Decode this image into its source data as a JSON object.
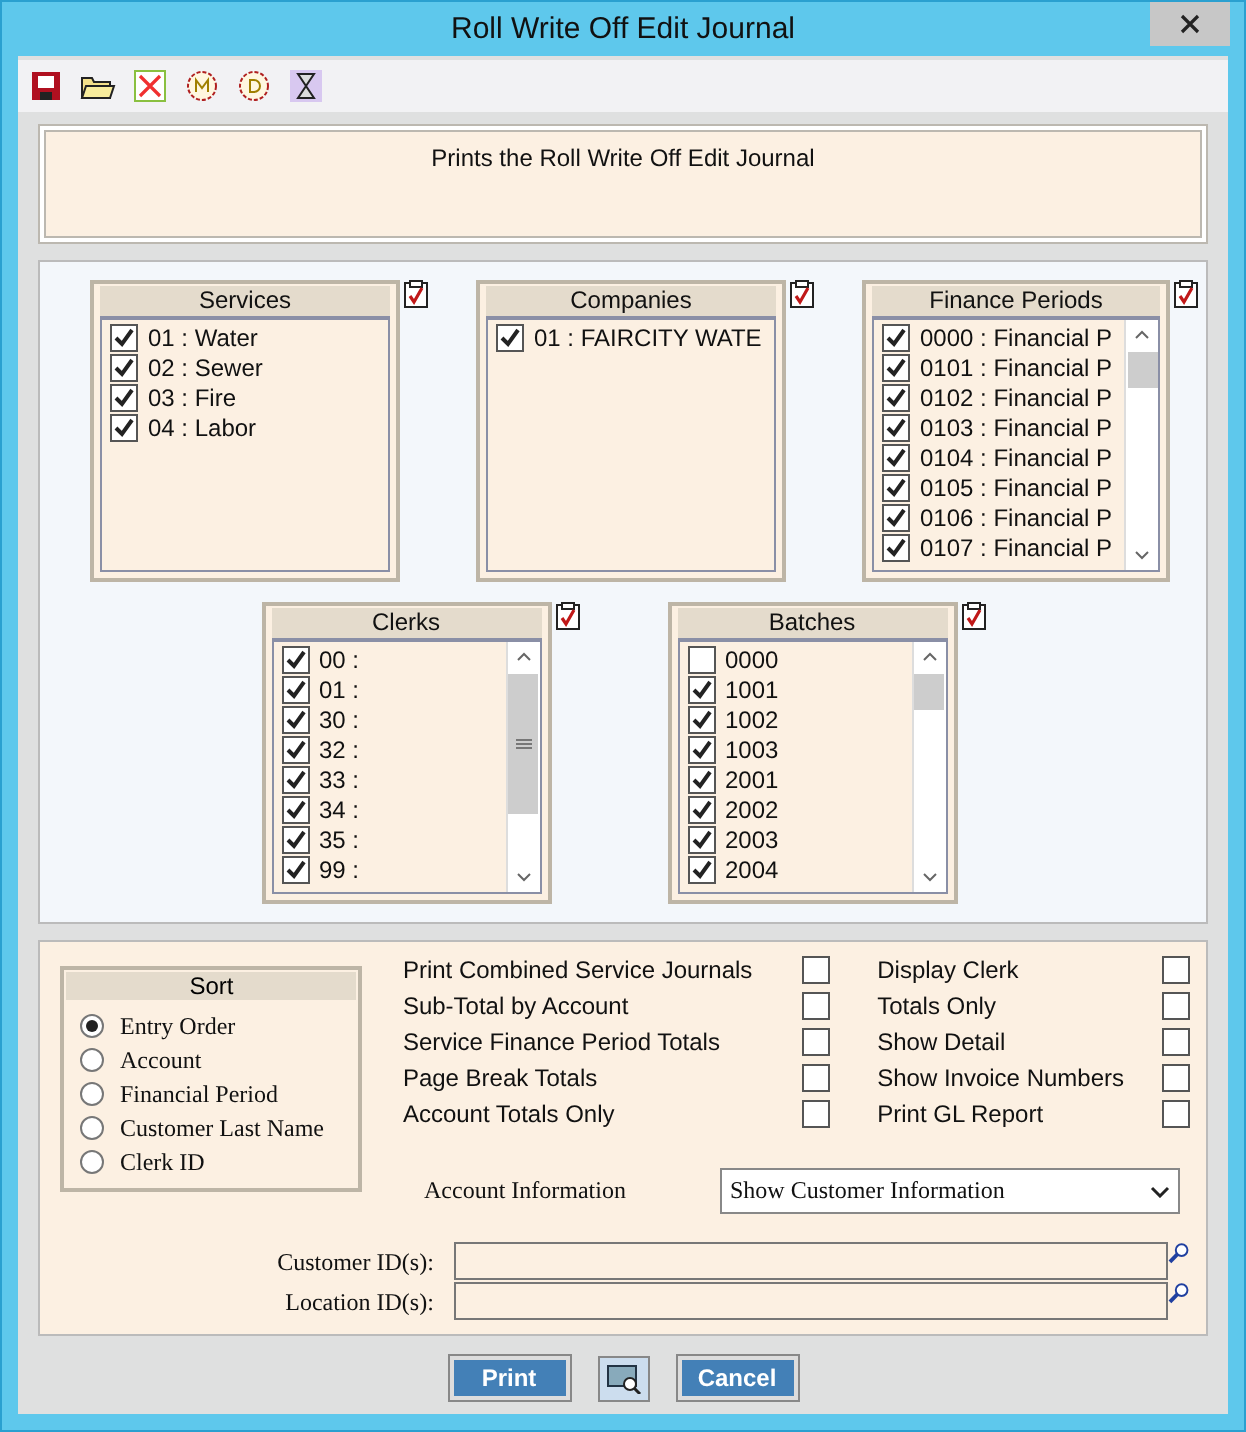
{
  "window": {
    "title": "Roll Write Off Edit Journal"
  },
  "description": "Prints the Roll Write Off Edit Journal",
  "lists": [
    {
      "title": "Services",
      "scrollbar": false,
      "items": [
        {
          "text": "01 : Water",
          "checked": true
        },
        {
          "text": "02 : Sewer",
          "checked": true
        },
        {
          "text": "03 : Fire",
          "checked": true
        },
        {
          "text": "04 : Labor",
          "checked": true
        }
      ]
    },
    {
      "title": "Companies",
      "scrollbar": false,
      "items": [
        {
          "text": "01 : FAIRCITY WATE",
          "checked": true
        }
      ]
    },
    {
      "title": "Finance Periods",
      "scrollbar": true,
      "items": [
        {
          "text": "0000 : Financial P",
          "checked": true
        },
        {
          "text": "0101 : Financial P",
          "checked": true
        },
        {
          "text": "0102 : Financial P",
          "checked": true
        },
        {
          "text": "0103 : Financial P",
          "checked": true
        },
        {
          "text": "0104 : Financial P",
          "checked": true
        },
        {
          "text": "0105 : Financial P",
          "checked": true
        },
        {
          "text": "0106 : Financial P",
          "checked": true
        },
        {
          "text": "0107 : Financial P",
          "checked": true
        }
      ]
    },
    {
      "title": "Clerks",
      "scrollbar": true,
      "items": [
        {
          "text": "00 :",
          "checked": true
        },
        {
          "text": "01 :",
          "checked": true
        },
        {
          "text": "30 :",
          "checked": true
        },
        {
          "text": "32 :",
          "checked": true
        },
        {
          "text": "33 :",
          "checked": true
        },
        {
          "text": "34 :",
          "checked": true
        },
        {
          "text": "35 :",
          "checked": true
        },
        {
          "text": "99 :",
          "checked": true
        }
      ]
    },
    {
      "title": "Batches",
      "scrollbar": true,
      "items": [
        {
          "text": "0000",
          "checked": false
        },
        {
          "text": "1001",
          "checked": true
        },
        {
          "text": "1002",
          "checked": true
        },
        {
          "text": "1003",
          "checked": true
        },
        {
          "text": "2001",
          "checked": true
        },
        {
          "text": "2002",
          "checked": true
        },
        {
          "text": "2003",
          "checked": true
        },
        {
          "text": "2004",
          "checked": true
        }
      ]
    }
  ],
  "sort": {
    "title": "Sort",
    "options": [
      {
        "label": "Entry Order",
        "selected": true
      },
      {
        "label": "Account",
        "selected": false
      },
      {
        "label": "Financial Period",
        "selected": false
      },
      {
        "label": "Customer Last Name",
        "selected": false
      },
      {
        "label": "Clerk ID",
        "selected": false
      }
    ]
  },
  "options_left": [
    {
      "label": "Print Combined Service Journals",
      "checked": false
    },
    {
      "label": "Sub-Total by Account",
      "checked": false
    },
    {
      "label": "Service Finance Period Totals",
      "checked": false
    },
    {
      "label": "Page Break Totals",
      "checked": false
    },
    {
      "label": "Account Totals Only",
      "checked": false
    }
  ],
  "options_right": [
    {
      "label": "Display Clerk",
      "checked": false
    },
    {
      "label": "Totals Only",
      "checked": false
    },
    {
      "label": "Show Detail",
      "checked": false
    },
    {
      "label": "Show Invoice Numbers",
      "checked": false
    },
    {
      "label": "Print GL Report",
      "checked": false
    }
  ],
  "account_information": {
    "label": "Account Information",
    "value": "Show Customer Information"
  },
  "id_fields": [
    {
      "label": "Customer ID(s):"
    },
    {
      "label": "Location ID(s):"
    }
  ],
  "buttons": {
    "print": "Print",
    "cancel": "Cancel"
  }
}
